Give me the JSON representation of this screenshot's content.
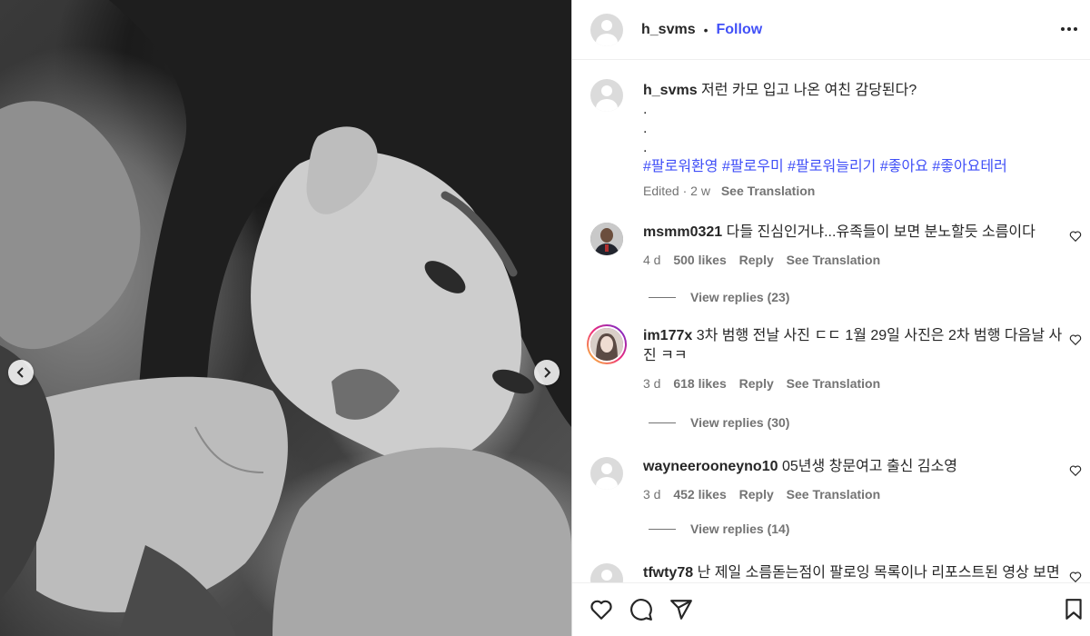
{
  "post": {
    "username": "h_svms",
    "follow_label": "Follow",
    "dot": "•",
    "caption": {
      "username": "h_svms",
      "text": "저런 카모 입고 나온 여친 감당된다?",
      "dots": [
        ".",
        ".",
        "."
      ],
      "hashtags": "#팔로워환영 #팔로우미 #팔로워늘리기 #좋아요 #좋아요테러",
      "edited": "Edited",
      "time": "2 w",
      "see_translation": "See Translation"
    }
  },
  "comments": [
    {
      "username": "msmm0321",
      "text": "다들 진심인거냐...유족들이 보면 분노할듯 소름이다",
      "time": "4 d",
      "likes": "500 likes",
      "reply": "Reply",
      "see_translation": "See Translation",
      "view_replies": "View replies (23)"
    },
    {
      "username": "im177x",
      "text": "3차 범행 전날 사진 ㄷㄷ 1월 29일 사진은 2차 범행 다음날 사진 ㅋㅋ",
      "time": "3 d",
      "likes": "618 likes",
      "reply": "Reply",
      "see_translation": "See Translation",
      "view_replies": "View replies (30)"
    },
    {
      "username": "wayneerooneyno10",
      "text": "05년생 창문여고 출신 김소영",
      "time": "3 d",
      "likes": "452 likes",
      "reply": "Reply",
      "see_translation": "See Translation",
      "view_replies": "View replies (14)"
    },
    {
      "username": "tfwty78",
      "text": "난 제일 소름돋는점이 팔로잉 목록이나 리포스트된 영상 보면"
    }
  ],
  "icons": {
    "more": "more-options-icon",
    "prev": "chevron-left-icon",
    "next": "chevron-right-icon",
    "like": "heart-icon",
    "comment": "comment-icon",
    "share": "share-icon",
    "save": "bookmark-icon"
  },
  "colors": {
    "accent": "#4150f7",
    "secondary_text": "#737373",
    "border": "#dbdbdb"
  }
}
